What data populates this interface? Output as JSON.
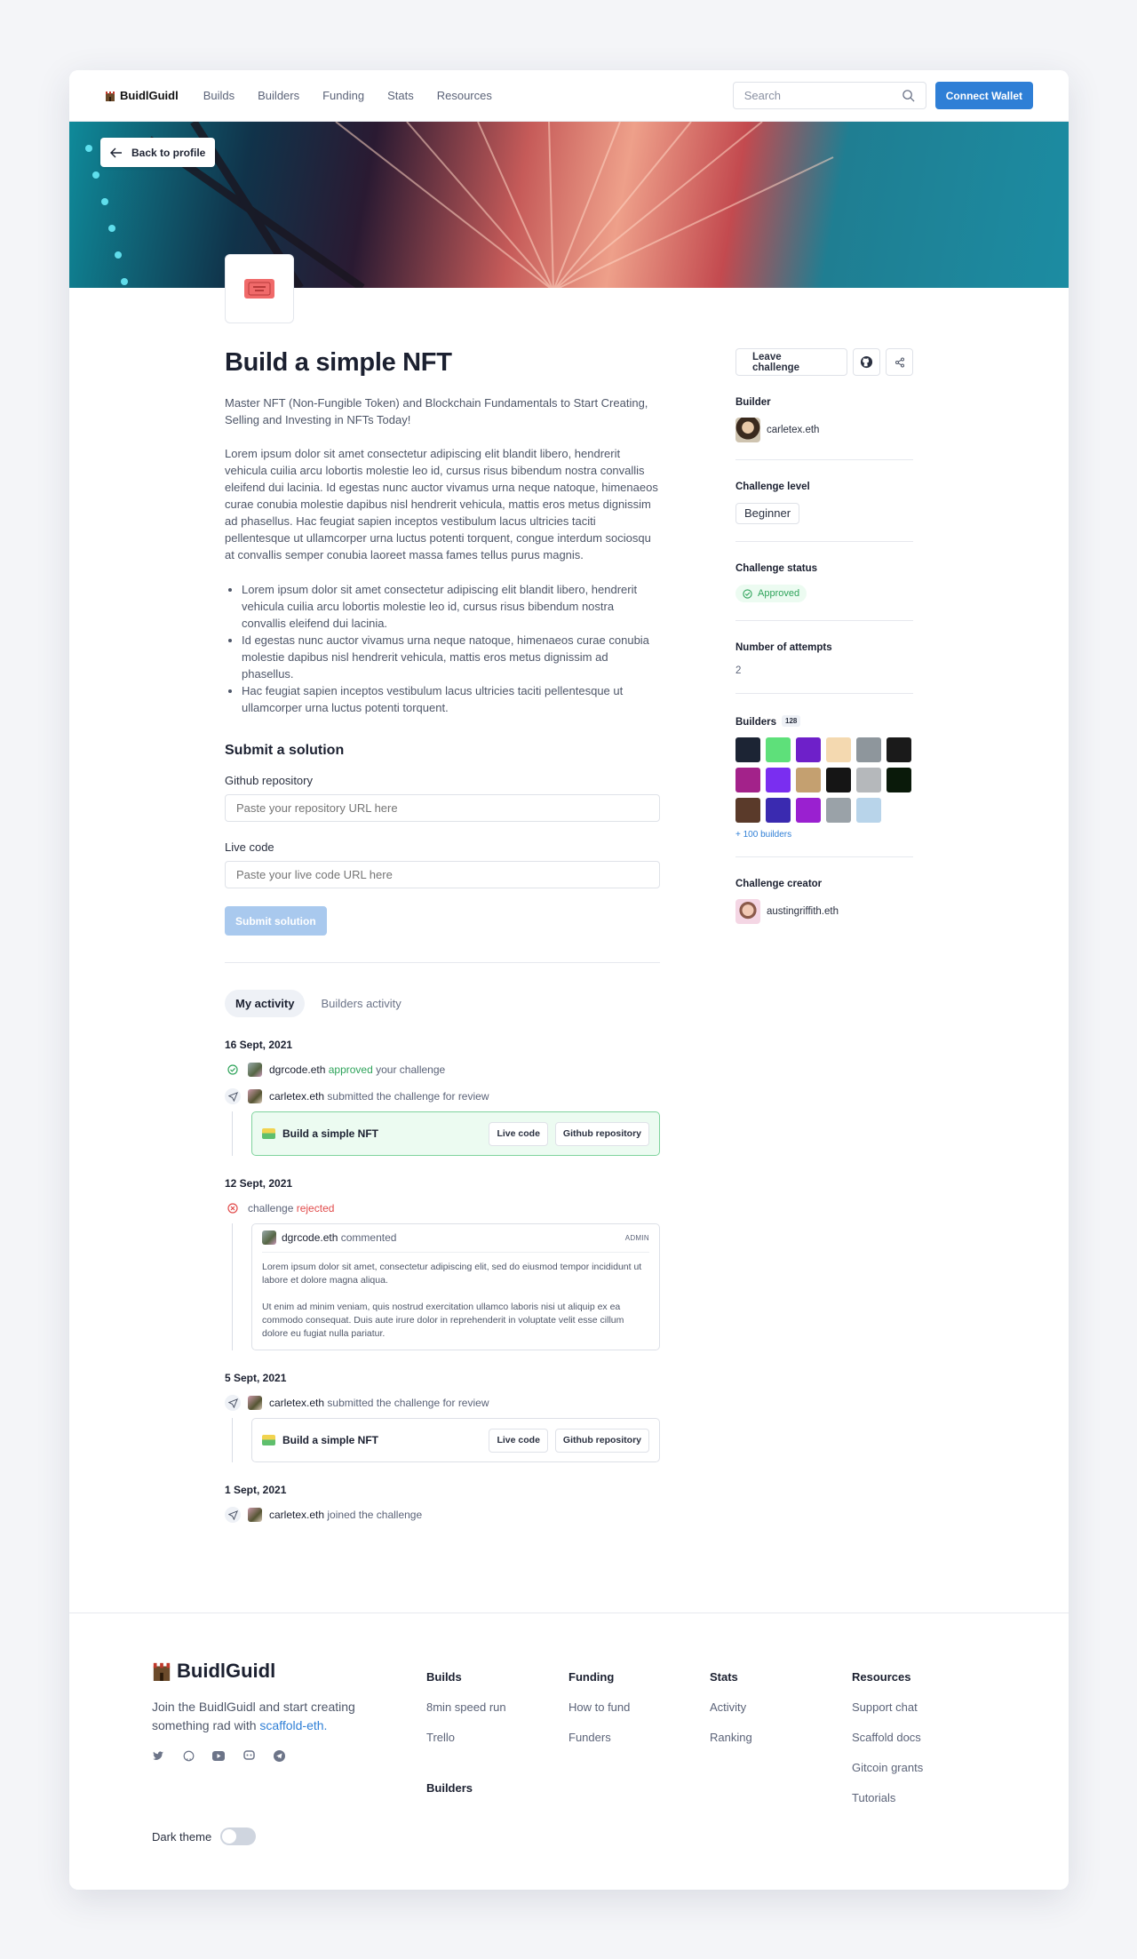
{
  "nav": {
    "logo": "BuidlGuidl",
    "links": [
      "Builds",
      "Builders",
      "Funding",
      "Stats",
      "Resources"
    ],
    "search_placeholder": "Search",
    "connect_label": "Connect Wallet"
  },
  "banner": {
    "back_label": "Back to profile"
  },
  "challenge": {
    "title": "Build a simple NFT",
    "intro": "Master NFT (Non-Fungible Token) and Blockchain Fundamentals to Start Creating, Selling and Investing in NFTs Today!",
    "body": "Lorem ipsum dolor sit amet consectetur adipiscing elit blandit libero, hendrerit vehicula cuilia arcu lobortis molestie leo id, cursus risus bibendum nostra convallis eleifend dui lacinia. Id egestas nunc auctor vivamus urna neque natoque, himenaeos curae conubia molestie dapibus nisl hendrerit vehicula, mattis eros metus dignissim ad phasellus. Hac feugiat sapien inceptos vestibulum lacus ultricies taciti pellentesque ut ullamcorper urna luctus potenti torquent, congue interdum sociosqu at convallis semper conubia laoreet massa fames tellus purus magnis.",
    "bullets": [
      "Lorem ipsum dolor sit amet consectetur adipiscing elit blandit libero, hendrerit vehicula cuilia arcu lobortis molestie leo id, cursus risus bibendum nostra convallis eleifend dui lacinia.",
      "Id egestas nunc auctor vivamus urna neque natoque, himenaeos curae conubia molestie dapibus nisl hendrerit vehicula, mattis eros metus dignissim ad phasellus.",
      "Hac feugiat sapien inceptos vestibulum lacus ultricies taciti pellentesque ut ullamcorper urna luctus potenti torquent."
    ]
  },
  "submit": {
    "heading": "Submit a solution",
    "github_label": "Github repository",
    "github_placeholder": "Paste your repository URL here",
    "live_label": "Live code",
    "live_placeholder": "Paste your live code URL here",
    "button": "Submit solution"
  },
  "tabs": [
    "My activity",
    "Builders activity"
  ],
  "activity": {
    "d1": "16 Sept, 2021",
    "e1_name": "dgrcode.eth",
    "e1_status": "approved",
    "e1_rest": "your challenge",
    "e2_name": "carletex.eth",
    "e2_rest": "submitted the challenge for review",
    "card_title": "Build a simple NFT",
    "live_btn": "Live code",
    "github_btn": "Github repository",
    "d2": "12 Sept, 2021",
    "e3_pre": "challenge",
    "e3_status": "rejected",
    "c_name": "dgrcode.eth",
    "c_rest": "commented",
    "c_badge": "ADMIN",
    "c_p1": "Lorem ipsum dolor sit amet, consectetur adipiscing elit, sed do eiusmod tempor incididunt ut labore et dolore magna aliqua.",
    "c_p2": "Ut enim ad minim veniam, quis nostrud exercitation ullamco laboris nisi ut aliquip ex ea commodo consequat. Duis aute irure dolor in reprehenderit in voluptate velit esse cillum dolore eu fugiat nulla pariatur.",
    "d3": "5 Sept, 2021",
    "e4_name": "carletex.eth",
    "e4_rest": "submitted the challenge for review",
    "d4": "1 Sept, 2021",
    "e5_name": "carletex.eth",
    "e5_rest": "joined the challenge"
  },
  "sidebar": {
    "leave_label": "Leave challenge",
    "builder_heading": "Builder",
    "builder_name": "carletex.eth",
    "level_heading": "Challenge level",
    "level": "Beginner",
    "status_heading": "Challenge status",
    "status": "Approved",
    "attempts_heading": "Number of attempts",
    "attempts": "2",
    "builders_heading": "Builders",
    "builders_count": "128",
    "more_builders": "+ 100 builders",
    "creator_heading": "Challenge creator",
    "creator_name": "austingriffith.eth",
    "builder_colors": [
      "#1c2434",
      "#5ee07a",
      "#6e20c9",
      "#f4d9b0",
      "#8e969c",
      "#1a1a1a",
      "#a3228a",
      "#7a2ef0",
      "#c4a070",
      "#151515",
      "#b5b8bb",
      "#0a1a0a",
      "#5a3a2a",
      "#3a2ab0",
      "#9a20d0",
      "#9aa2a8",
      "#b8d4ea"
    ]
  },
  "footer": {
    "logo": "BuidlGuidl",
    "text": "Join the BuidlGuidl and start creating something rad with",
    "link": "scaffold-eth.",
    "dark_label": "Dark theme",
    "cols": [
      {
        "title": "Builds",
        "links": [
          "8min speed run",
          "Trello"
        ]
      },
      {
        "title": "Builders",
        "links": []
      },
      {
        "title": "Funding",
        "links": [
          "How to fund",
          "Funders"
        ]
      },
      {
        "title": "Stats",
        "links": [
          "Activity",
          "Ranking"
        ]
      },
      {
        "title": "Resources",
        "links": [
          "Support chat",
          "Scaffold docs",
          "Gitcoin grants",
          "Tutorials"
        ]
      }
    ]
  }
}
